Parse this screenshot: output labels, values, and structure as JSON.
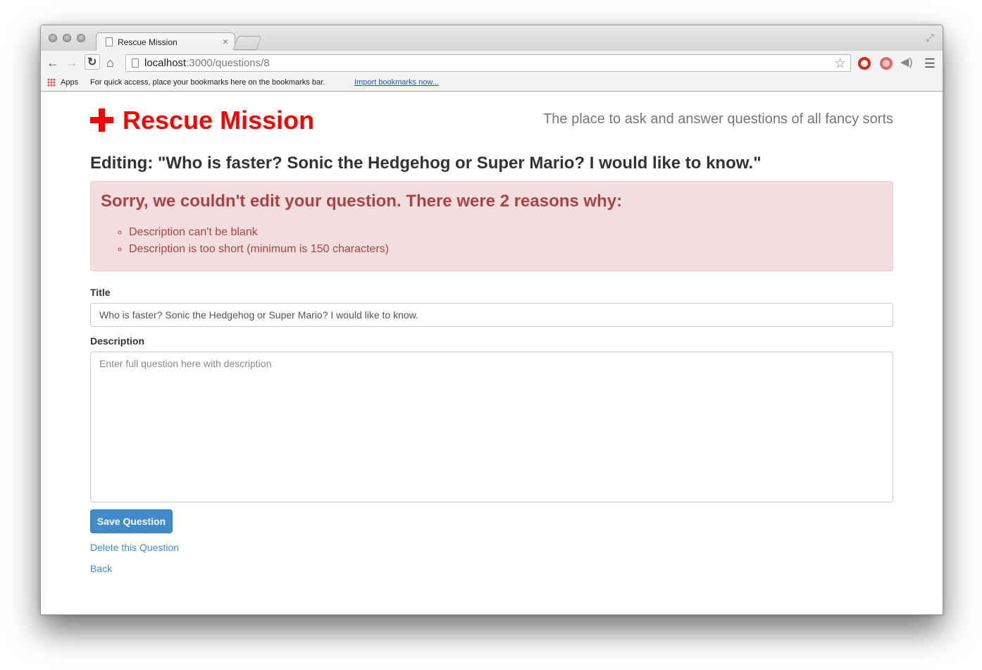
{
  "browser": {
    "tab_title": "Rescue Mission",
    "tab_close": "×",
    "url_host": "localhost",
    "url_rest": ":3000/questions/8",
    "bookmarks": {
      "apps_label": "Apps",
      "message": "For quick access, place your bookmarks here on the bookmarks bar.",
      "import_link": "Import bookmarks now..."
    }
  },
  "header": {
    "brand": "Rescue Mission",
    "tagline": "The place to ask and answer questions of all fancy sorts"
  },
  "page": {
    "heading": "Editing: \"Who is faster? Sonic the Hedgehog or Super Mario? I would like to know.\""
  },
  "alert": {
    "title": "Sorry, we couldn't edit your question. There were 2 reasons why:",
    "errors": [
      "Description can't be blank",
      "Description is too short (minimum is 150 characters)"
    ]
  },
  "form": {
    "title_label": "Title",
    "title_value": "Who is faster? Sonic the Hedgehog or Super Mario? I would like to know.",
    "description_label": "Description",
    "description_placeholder": "Enter full question here with description",
    "save_label": "Save Question"
  },
  "links": {
    "delete": "Delete this Question",
    "back": "Back"
  },
  "colors": {
    "brand_red": "#ff0000",
    "alert_bg": "#f2dede",
    "alert_text": "#a94442",
    "primary": "#428bca"
  }
}
